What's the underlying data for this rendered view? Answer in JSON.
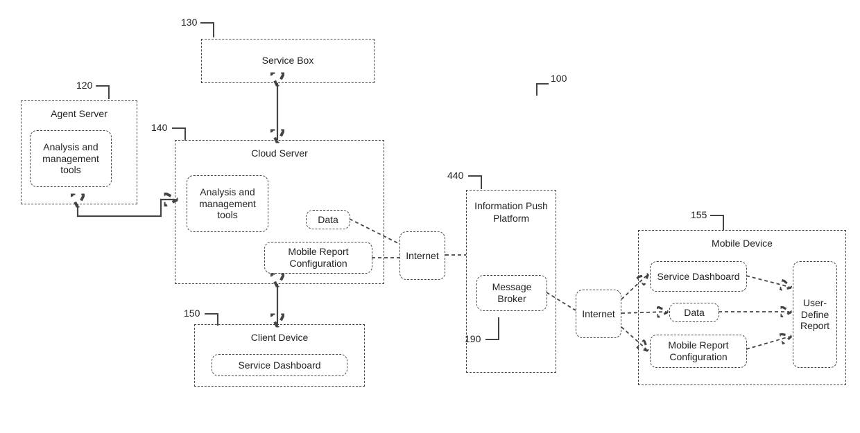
{
  "refs": {
    "system": "100",
    "agent_server": "120",
    "service_box": "130",
    "cloud_server": "140",
    "client_device": "150",
    "mobile_device": "155",
    "push_platform": "440",
    "message_broker": "190"
  },
  "agent_server": {
    "title": "Agent Server",
    "tools": "Analysis and management tools"
  },
  "service_box": {
    "title": "Service Box"
  },
  "cloud_server": {
    "title": "Cloud Server",
    "tools": "Analysis and management tools",
    "data": "Data",
    "mobile_config": "Mobile Report Configuration"
  },
  "client_device": {
    "title": "Client Device",
    "dashboard": "Service Dashboard"
  },
  "internet1": "Internet",
  "push_platform": {
    "title": "Information Push Platform",
    "broker": "Message Broker"
  },
  "internet2": "Internet",
  "mobile_device": {
    "title": "Mobile Device",
    "dashboard": "Service Dashboard",
    "data": "Data",
    "mobile_config": "Mobile Report Configuration",
    "report": "User-Define Report"
  }
}
